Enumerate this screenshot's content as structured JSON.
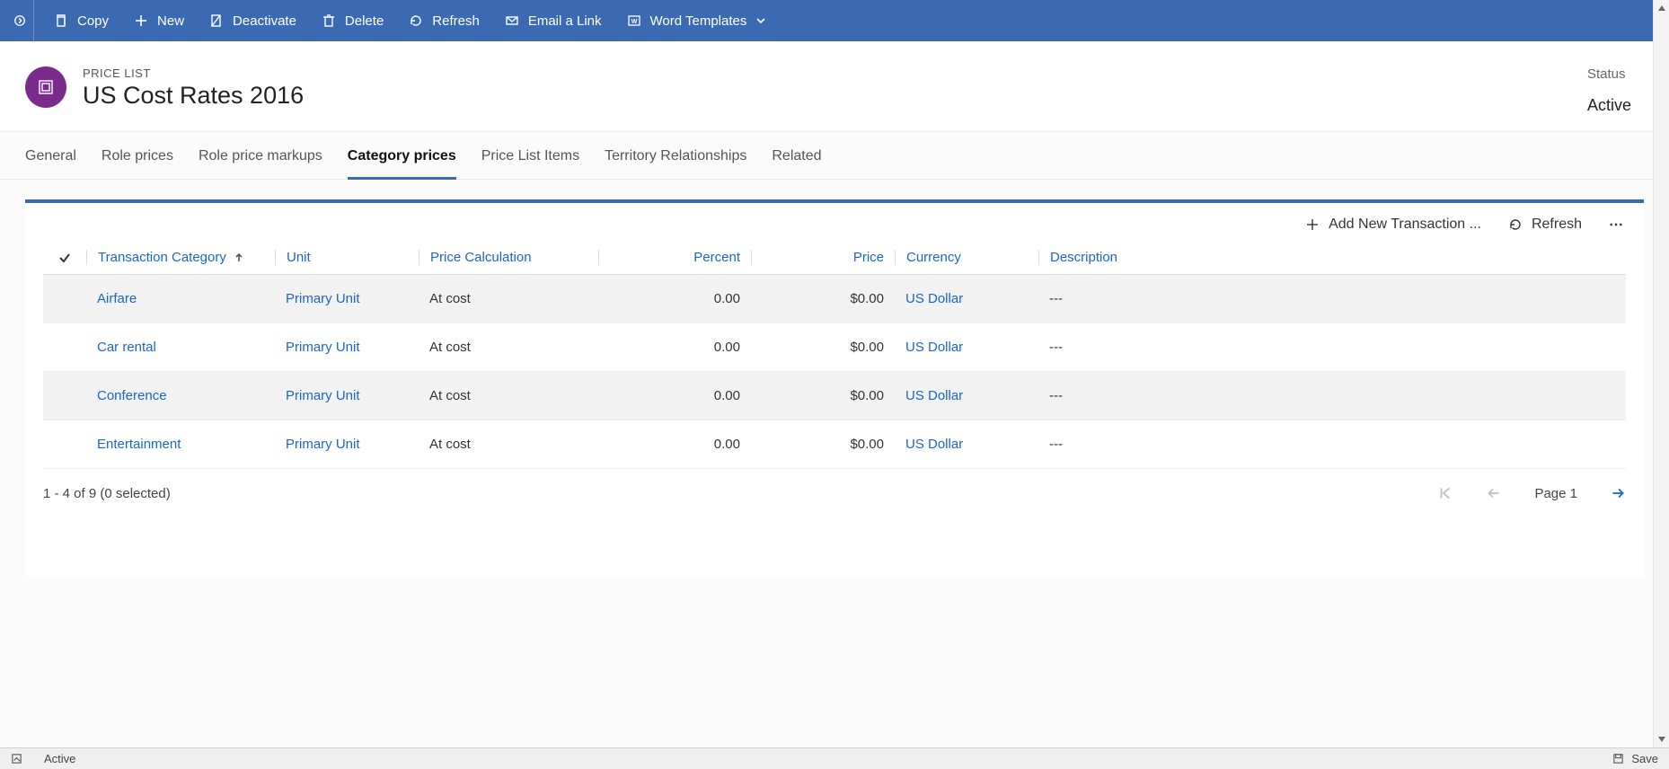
{
  "commandBar": {
    "copy": "Copy",
    "new": "New",
    "deactivate": "Deactivate",
    "delete": "Delete",
    "refresh": "Refresh",
    "emailLink": "Email a Link",
    "wordTemplates": "Word Templates"
  },
  "header": {
    "entityLabel": "PRICE LIST",
    "title": "US Cost Rates 2016",
    "statusLabel": "Status",
    "statusValue": "Active"
  },
  "tabs": {
    "general": "General",
    "rolePrices": "Role prices",
    "rolePriceMarkups": "Role price markups",
    "categoryPrices": "Category prices",
    "priceListItems": "Price List Items",
    "territory": "Territory Relationships",
    "related": "Related"
  },
  "grid": {
    "toolbar": {
      "addNew": "Add New Transaction ...",
      "refresh": "Refresh"
    },
    "columns": {
      "transactionCategory": "Transaction Category",
      "unit": "Unit",
      "priceCalc": "Price Calculation",
      "percent": "Percent",
      "price": "Price",
      "currency": "Currency",
      "description": "Description"
    },
    "rows": [
      {
        "category": "Airfare",
        "unit": "Primary Unit",
        "calc": "At cost",
        "percent": "0.00",
        "price": "$0.00",
        "currency": "US Dollar",
        "desc": "---"
      },
      {
        "category": "Car rental",
        "unit": "Primary Unit",
        "calc": "At cost",
        "percent": "0.00",
        "price": "$0.00",
        "currency": "US Dollar",
        "desc": "---"
      },
      {
        "category": "Conference",
        "unit": "Primary Unit",
        "calc": "At cost",
        "percent": "0.00",
        "price": "$0.00",
        "currency": "US Dollar",
        "desc": "---"
      },
      {
        "category": "Entertainment",
        "unit": "Primary Unit",
        "calc": "At cost",
        "percent": "0.00",
        "price": "$0.00",
        "currency": "US Dollar",
        "desc": "---"
      }
    ],
    "footer": {
      "count": "1 - 4 of 9 (0 selected)",
      "page": "Page 1"
    }
  },
  "statusBar": {
    "state": "Active",
    "save": "Save"
  }
}
